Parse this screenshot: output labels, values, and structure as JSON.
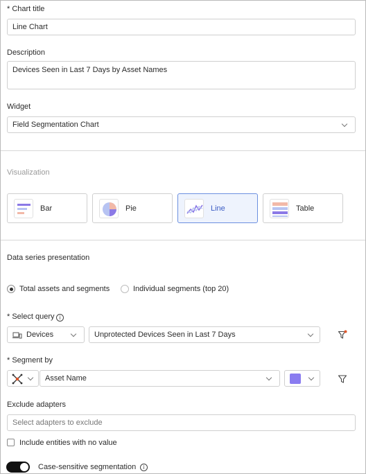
{
  "chart_title": {
    "label": "* Chart title",
    "value": "Line Chart"
  },
  "description": {
    "label": "Description",
    "value": "Devices Seen in Last 7 Days by Asset Names"
  },
  "widget": {
    "label": "Widget",
    "value": "Field Segmentation Chart"
  },
  "visualization": {
    "label": "Visualization",
    "options": [
      {
        "label": "Bar"
      },
      {
        "label": "Pie"
      },
      {
        "label": "Line"
      },
      {
        "label": "Table"
      }
    ],
    "selected": "Line"
  },
  "data_series": {
    "label": "Data series presentation",
    "option_total": "Total assets and segments",
    "option_individual": "Individual segments (top 20)",
    "selected": "Total assets and segments"
  },
  "select_query": {
    "label": "* Select query",
    "entity": "Devices",
    "query": "Unprotected Devices Seen in Last 7 Days"
  },
  "segment_by": {
    "label": "* Segment by",
    "field": "Asset Name",
    "color": "#8a7cf0"
  },
  "exclude_adapters": {
    "label": "Exclude adapters",
    "placeholder": "Select adapters to exclude"
  },
  "include_no_value": {
    "label": "Include entities with no value",
    "checked": false
  },
  "case_sensitive": {
    "label": "Case-sensitive segmentation",
    "enabled": true
  },
  "colors": {
    "accent": "#3b5cc4",
    "filter_dot": "#e0572b"
  }
}
